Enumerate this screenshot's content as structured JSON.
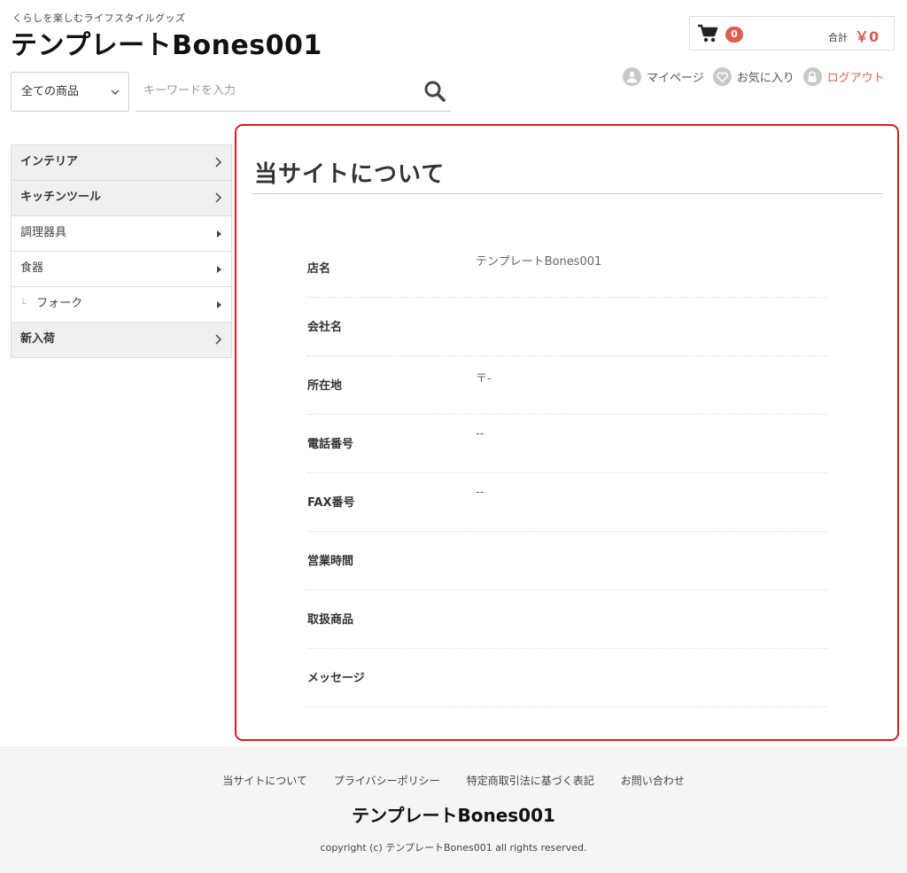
{
  "header": {
    "tagline": "くらしを楽しむライフスタイルグッズ",
    "logo": "テンプレートBones001"
  },
  "cart": {
    "count": "0",
    "total_label": "合計",
    "total_value": "￥0"
  },
  "user_nav": {
    "mypage": "マイページ",
    "favorites": "お気に入り",
    "logout": "ログアウト"
  },
  "search": {
    "category": "全ての商品",
    "placeholder": "キーワードを入力"
  },
  "sidebar": {
    "items": [
      {
        "label": "インテリア",
        "level": "top"
      },
      {
        "label": "キッチンツール",
        "level": "top"
      },
      {
        "label": "調理器具",
        "level": "sub"
      },
      {
        "label": "食器",
        "level": "sub"
      },
      {
        "label": "フォーク",
        "level": "subsub"
      },
      {
        "label": "新入荷",
        "level": "top"
      }
    ]
  },
  "main": {
    "title": "当サイトについて",
    "rows": [
      {
        "label": "店名",
        "value": "テンプレートBones001"
      },
      {
        "label": "会社名",
        "value": ""
      },
      {
        "label": "所在地",
        "value": "〒-"
      },
      {
        "label": "電話番号",
        "value": "--"
      },
      {
        "label": "FAX番号",
        "value": "--"
      },
      {
        "label": "営業時間",
        "value": ""
      },
      {
        "label": "取扱商品",
        "value": ""
      },
      {
        "label": "メッセージ",
        "value": ""
      }
    ]
  },
  "footer": {
    "links": [
      "当サイトについて",
      "プライバシーポリシー",
      "特定商取引法に基づく表記",
      "お問い合わせ"
    ],
    "logo": "テンプレートBones001",
    "copyright": "copyright (c) テンプレートBones001 all rights reserved."
  },
  "colors": {
    "accent": "#de5d50",
    "highlight_border": "#e01c1c"
  }
}
